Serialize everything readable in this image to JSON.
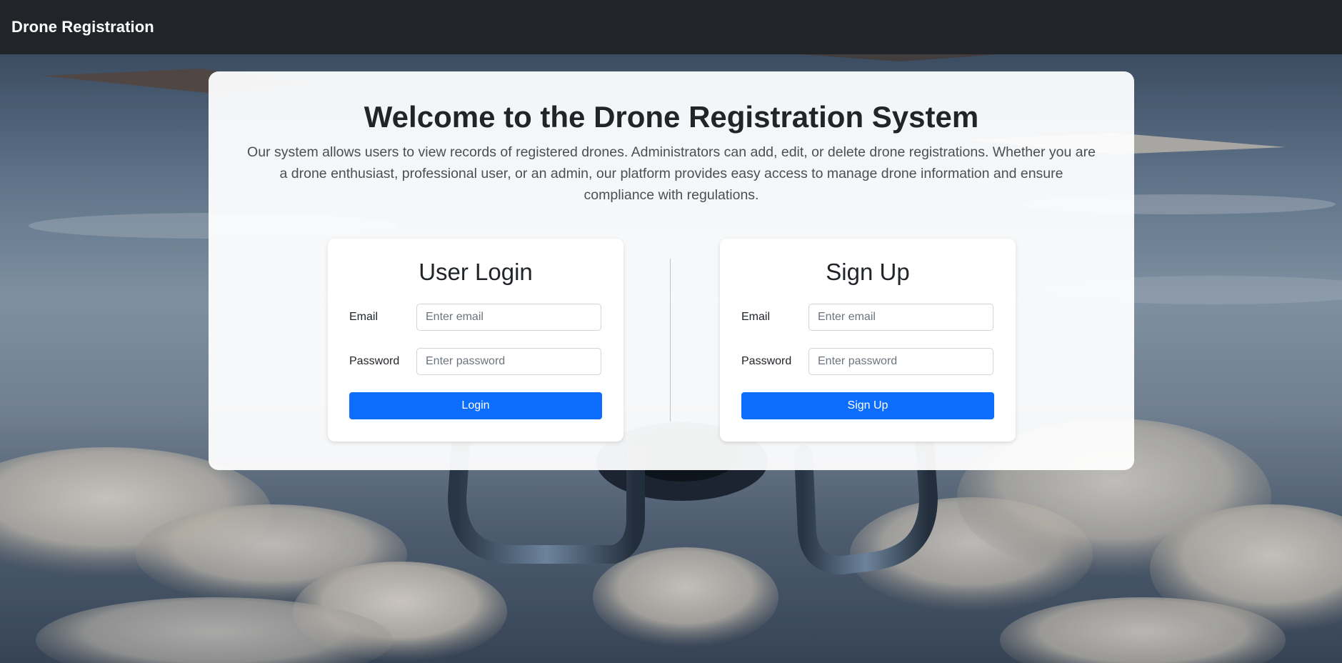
{
  "navbar": {
    "brand": "Drone Registration"
  },
  "hero": {
    "title": "Welcome to the Drone Registration System",
    "description": "Our system allows users to view records of registered drones. Administrators can add, edit, or delete drone registrations. Whether you are a drone enthusiast, professional user, or an admin, our platform provides easy access to manage drone information and ensure compliance with regulations."
  },
  "login": {
    "title": "User Login",
    "email_label": "Email",
    "email_placeholder": "Enter email",
    "password_label": "Password",
    "password_placeholder": "Enter password",
    "button": "Login"
  },
  "signup": {
    "title": "Sign Up",
    "email_label": "Email",
    "email_placeholder": "Enter email",
    "password_label": "Password",
    "password_placeholder": "Enter password",
    "button": "Sign Up"
  },
  "colors": {
    "navbar_bg": "#212529",
    "primary_button": "#0d6efd"
  }
}
